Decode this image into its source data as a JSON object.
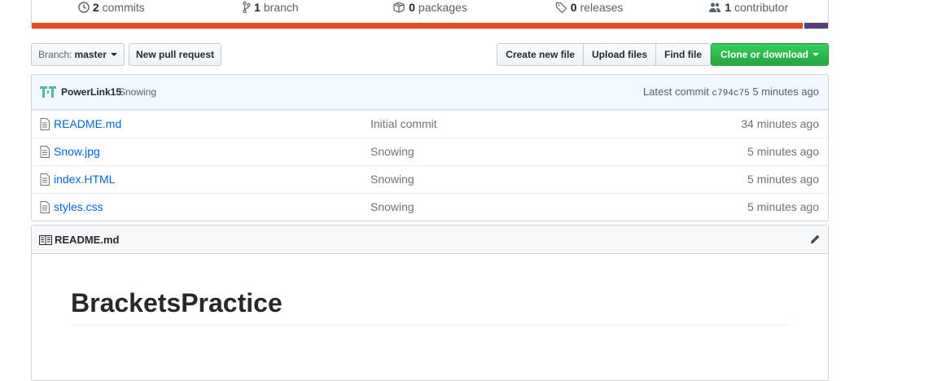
{
  "summary": {
    "commits": {
      "count": "2",
      "label": "commits"
    },
    "branches": {
      "count": "1",
      "label": "branch"
    },
    "packages": {
      "count": "0",
      "label": "packages"
    },
    "releases": {
      "count": "0",
      "label": "releases"
    },
    "contributors": {
      "count": "1",
      "label": "contributor"
    }
  },
  "language_bar": [
    {
      "color": "#e34c26",
      "percent": 97.0
    },
    {
      "color": "#563d7c",
      "percent": 3.0
    }
  ],
  "file_nav": {
    "branch_prefix": "Branch:",
    "branch_name": "master",
    "new_pull_request": "New pull request",
    "create_new_file": "Create new file",
    "upload_files": "Upload files",
    "find_file": "Find file",
    "clone_or_download": "Clone or download"
  },
  "commit_tease": {
    "author": "PowerLink15",
    "message": "Snowing",
    "latest_label": "Latest commit",
    "sha": "c794c75",
    "age": "5 minutes ago"
  },
  "files": [
    {
      "name": "README.md",
      "message": "Initial commit",
      "age": "34 minutes ago"
    },
    {
      "name": "Snow.jpg",
      "message": "Snowing",
      "age": "5 minutes ago"
    },
    {
      "name": "index.HTML",
      "message": "Snowing",
      "age": "5 minutes ago"
    },
    {
      "name": "styles.css",
      "message": "Snowing",
      "age": "5 minutes ago"
    }
  ],
  "readme": {
    "filename": "README.md",
    "heading": "BracketsPractice"
  },
  "colors": {
    "link": "#0366d6",
    "green_button": "#28a745",
    "commit_bg": "#f1f8ff"
  }
}
